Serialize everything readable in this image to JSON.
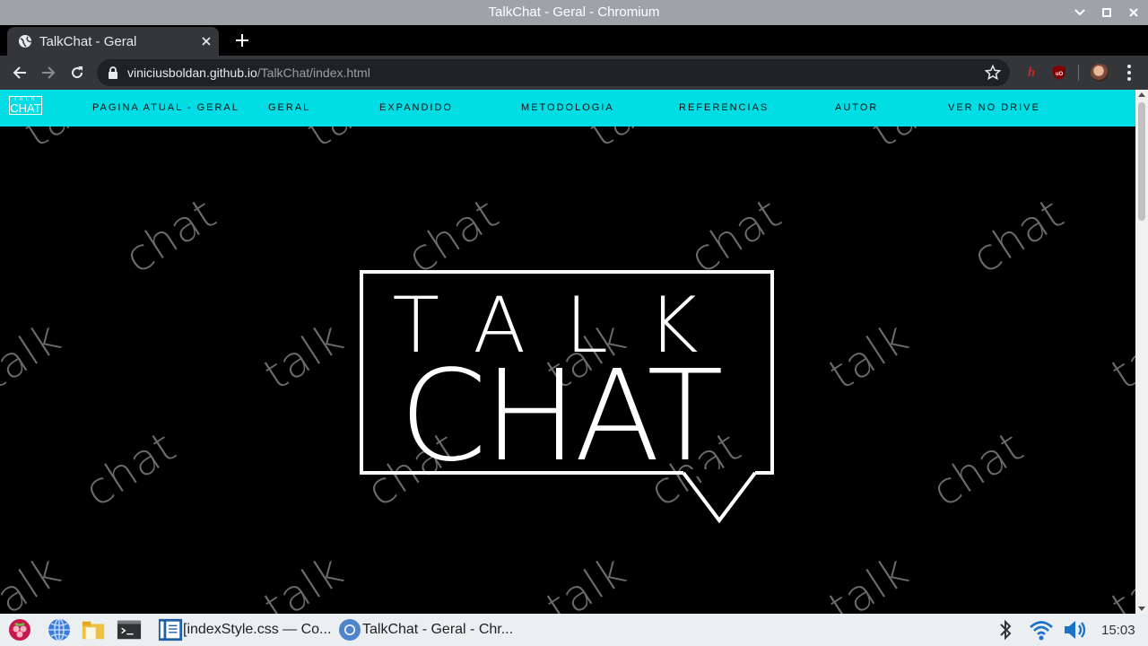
{
  "window": {
    "title": "TalkChat - Geral - Chromium"
  },
  "tabs": [
    {
      "title": "TalkChat - Geral",
      "icon": "globe-icon"
    }
  ],
  "address": {
    "host": "viniciusboldan.github.io",
    "path": "/TalkChat/index.html"
  },
  "site": {
    "logo": {
      "top": "TALK",
      "bottom": "CHAT"
    },
    "nav": [
      "PAGINA ATUAL - GERAL",
      "GERAL",
      "EXPANDIDO",
      "METODOLOGIA",
      "REFERENCIAS",
      "AUTOR",
      "VER NO DRIVE"
    ],
    "hero": {
      "line1": "TALK",
      "line2": "CHAT"
    },
    "background_words": [
      "talk",
      "chat"
    ],
    "colors": {
      "nav_bg": "#00dde4",
      "page_bg": "#000000",
      "logo": "#ffffff",
      "pattern": "#777777"
    }
  },
  "taskbar": {
    "items": [
      {
        "label": "[indexStyle.css — Co...",
        "icon": "text-editor-icon"
      },
      {
        "label": "TalkChat - Geral - Chr...",
        "icon": "chromium-icon"
      }
    ],
    "clock": "15:03"
  }
}
